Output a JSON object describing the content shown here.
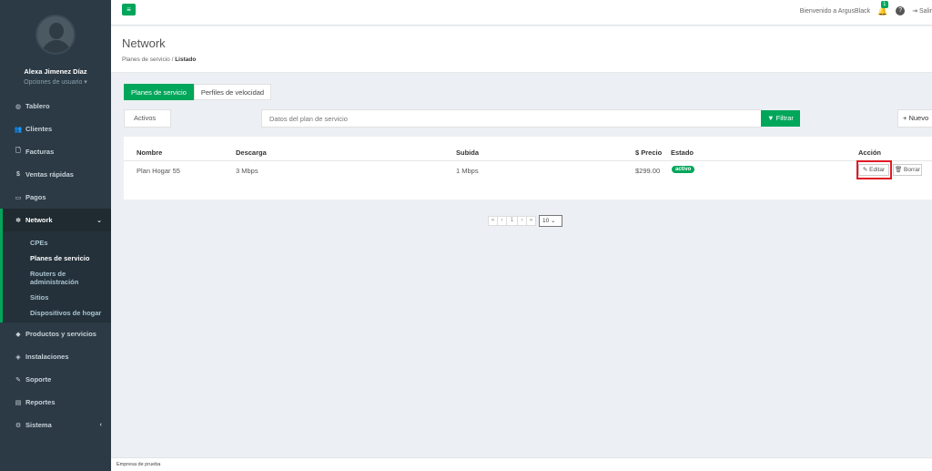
{
  "user": {
    "name": "Alexa Jimenez Díaz",
    "options_label": "Opciones de usuario ▾"
  },
  "nav": {
    "items": [
      {
        "label": "Tablero",
        "icon": "◍"
      },
      {
        "label": "Clientes",
        "icon": "👥"
      },
      {
        "label": "Facturas",
        "icon": "🗋"
      },
      {
        "label": "Ventas rápidas",
        "icon": "$"
      },
      {
        "label": "Pagos",
        "icon": "▭"
      },
      {
        "label": "Network",
        "icon": "✻",
        "chevron": "⌄"
      },
      {
        "label": "Productos y servicios",
        "icon": "◆"
      },
      {
        "label": "Instalaciones",
        "icon": "◈"
      },
      {
        "label": "Soporte",
        "icon": "✎"
      },
      {
        "label": "Reportes",
        "icon": "▤"
      },
      {
        "label": "Sistema",
        "icon": "⚙",
        "chevron": "‹"
      }
    ],
    "network_sub": [
      "CPEs",
      "Planes de servicio",
      "Routers de administración",
      "Sitios",
      "Dispositivos de hogar"
    ]
  },
  "topbar": {
    "menu_icon": "≡",
    "welcome": "Bienvenido a ArgusBlack",
    "bell_icon": "🔔",
    "notif_count": "1",
    "help_icon": "?",
    "logout_icon": "⇥",
    "logout_label": "Salir"
  },
  "header": {
    "title": "Network",
    "breadcrumb_parent": "Planes de servicio",
    "breadcrumb_sep": "/",
    "breadcrumb_current": "Listado"
  },
  "tabs": [
    "Planes de servicio",
    "Perfiles de velocidad"
  ],
  "filter": {
    "status": "Activos",
    "search_placeholder": "Datos del plan de servicio",
    "filter_label": "▼ Filtrar",
    "new_label": "+ Nuevo"
  },
  "table": {
    "columns": [
      "Nombre",
      "Descarga",
      "Subida",
      "$ Precio",
      "Estado",
      "Acción"
    ],
    "rows": [
      {
        "name": "Plan Hogar 55",
        "download": "3 Mbps",
        "upload": "1 Mbps",
        "price": "$299.00",
        "status": "activo"
      }
    ],
    "edit_label": "✎ Editar",
    "delete_label": "🗑 Borrar"
  },
  "pagination": {
    "first": "«",
    "prev": "‹",
    "page": "1",
    "next": "›",
    "last": "»",
    "per_page": "10 ⌄"
  },
  "footer": {
    "company": "Empresa de prueba"
  },
  "colors": {
    "accent": "#00a65a",
    "sidebar": "#2b3a45",
    "highlight": "#e01b24"
  }
}
